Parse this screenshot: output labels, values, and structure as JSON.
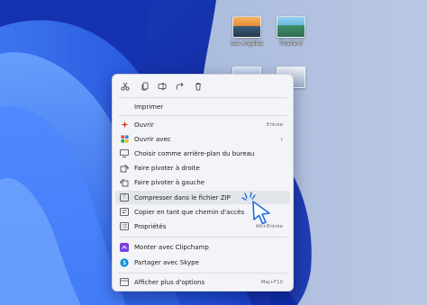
{
  "desktop": {
    "icons": [
      {
        "name": "image-icon",
        "label": "Los Angeles"
      },
      {
        "name": "image-icon",
        "label": "Thailand"
      },
      {
        "name": "image-icon",
        "label": ""
      },
      {
        "name": "image-icon",
        "label": ""
      }
    ]
  },
  "toolbar": {
    "buttons": [
      {
        "name": "cut-icon"
      },
      {
        "name": "copy-icon"
      },
      {
        "name": "rename-icon"
      },
      {
        "name": "share-icon"
      },
      {
        "name": "delete-icon"
      }
    ]
  },
  "menu": {
    "print": "Imprimer",
    "open": "Ouvrir",
    "open_shortcut": "Entrée",
    "open_with": "Ouvrir avec",
    "set_background": "Choisir comme arrière-plan du bureau",
    "rotate_right": "Faire pivoter à droite",
    "rotate_left": "Faire pivoter à gauche",
    "compress_zip": "Compresser dans le fichier ZIP",
    "copy_path": "Copier en tant que chemin d'accès",
    "properties": "Propriétés",
    "properties_shortcut": "Alt+Entrée",
    "clipchamp": "Monter avec Clipchamp",
    "skype": "Partager avec Skype",
    "more_options": "Afficher plus d'options",
    "more_options_shortcut": "Maj+F10"
  },
  "colors": {
    "accent": "#0f6cbd",
    "highlight": "#e2e5ea",
    "menu_bg": "#f3f4f7"
  }
}
